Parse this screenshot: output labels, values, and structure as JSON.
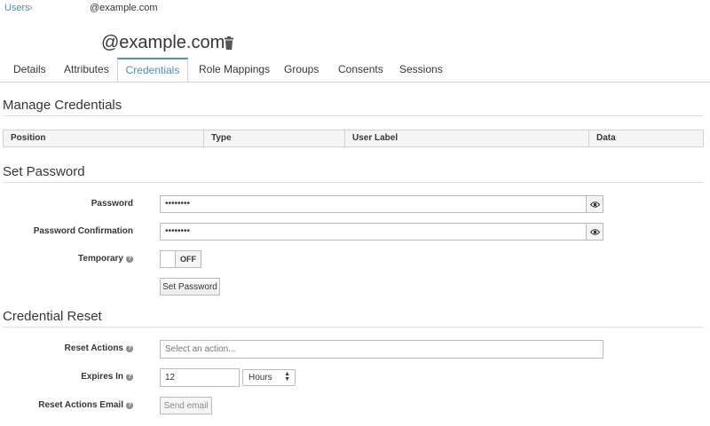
{
  "breadcrumb": {
    "parent": "Users",
    "separator": "›",
    "current": "@example.com"
  },
  "page_title": "@example.com",
  "tabs": [
    {
      "label": "Details"
    },
    {
      "label": "Attributes"
    },
    {
      "label": "Credentials",
      "active": true
    },
    {
      "label": "Role Mappings"
    },
    {
      "label": "Groups"
    },
    {
      "label": "Consents"
    },
    {
      "label": "Sessions"
    }
  ],
  "manage_credentials": {
    "heading": "Manage Credentials",
    "columns": [
      "Position",
      "Type",
      "User Label",
      "Data"
    ]
  },
  "set_password": {
    "heading": "Set Password",
    "password_label": "Password",
    "password_value": "••••••••",
    "confirm_label": "Password Confirmation",
    "confirm_value": "••••••••",
    "temporary_label": "Temporary",
    "temporary_state": "OFF",
    "submit_label": "Set Password"
  },
  "credential_reset": {
    "heading": "Credential Reset",
    "reset_actions_label": "Reset Actions",
    "reset_actions_placeholder": "Select an action...",
    "expires_label": "Expires In",
    "expires_value": "12",
    "expires_unit": "Hours",
    "email_label": "Reset Actions Email",
    "email_button": "Send email"
  },
  "icons": {
    "help": "question-circle-icon",
    "eye": "eye-icon",
    "trash": "trash-icon"
  },
  "colors": {
    "link": "#4a90c2",
    "text": "#363636"
  }
}
